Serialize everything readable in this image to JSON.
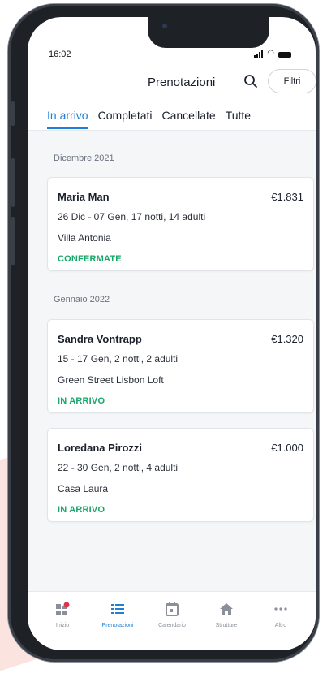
{
  "status_bar": {
    "time": "16:02"
  },
  "header": {
    "title": "Prenotazioni",
    "filter_label": "Filtri"
  },
  "tabs": [
    {
      "label": "In arrivo",
      "active": true
    },
    {
      "label": "Completati",
      "active": false
    },
    {
      "label": "Cancellate",
      "active": false
    },
    {
      "label": "Tutte",
      "active": false
    }
  ],
  "sections": [
    {
      "label": "Dicembre 2021",
      "bookings": [
        {
          "name": "Maria Man",
          "price": "€1.831",
          "dates": "26 Dic - 07 Gen, 17 notti, 14 adulti",
          "property": "Villa Antonia",
          "status": "CONFERMATE"
        }
      ]
    },
    {
      "label": "Gennaio 2022",
      "bookings": [
        {
          "name": "Sandra Vontrapp",
          "price": "€1.320",
          "dates": "15 - 17 Gen, 2 notti, 2 adulti",
          "property": "Green Street Lisbon Loft",
          "status": "IN ARRIVO"
        },
        {
          "name": "Loredana Pirozzi",
          "price": "€1.000",
          "dates": "22 - 30 Gen, 2 notti, 4 adulti",
          "property": "Casa Laura",
          "status": "IN ARRIVO"
        }
      ]
    }
  ],
  "tab_bar": [
    {
      "label": "Inizio",
      "icon": "home-grid-icon",
      "active": false
    },
    {
      "label": "Prenotazioni",
      "icon": "list-icon",
      "active": true
    },
    {
      "label": "Calendario",
      "icon": "calendar-icon",
      "active": false
    },
    {
      "label": "Strutture",
      "icon": "house-icon",
      "active": false
    },
    {
      "label": "Altro",
      "icon": "more-icon",
      "active": false
    }
  ],
  "colors": {
    "accent": "#1e7fd4",
    "status_green": "#1aa66a",
    "badge_red": "#e0314b"
  }
}
